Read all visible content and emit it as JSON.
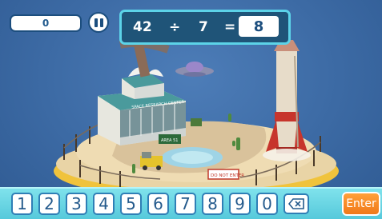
{
  "hud": {
    "score": "0"
  },
  "equation": {
    "dividend": "42",
    "operator": "÷",
    "divisor": "7",
    "equals": "=",
    "answer": "8"
  },
  "scene": {
    "building_sign": "SPACE RESEARCH CENTER",
    "area_sign": "AREA 51",
    "no_entry_sign": "DO NOT ENTER"
  },
  "keypad": {
    "keys": [
      "1",
      "2",
      "3",
      "4",
      "5",
      "6",
      "7",
      "8",
      "9",
      "0"
    ],
    "backspace_icon": "backspace-icon",
    "enter_label": "Enter"
  },
  "colors": {
    "background": "#3f6ea8",
    "equation_panel": "#1f5478",
    "equation_border": "#5cd3e8",
    "keypad_bar": "#63d2e2",
    "enter_button": "#f58a24"
  }
}
